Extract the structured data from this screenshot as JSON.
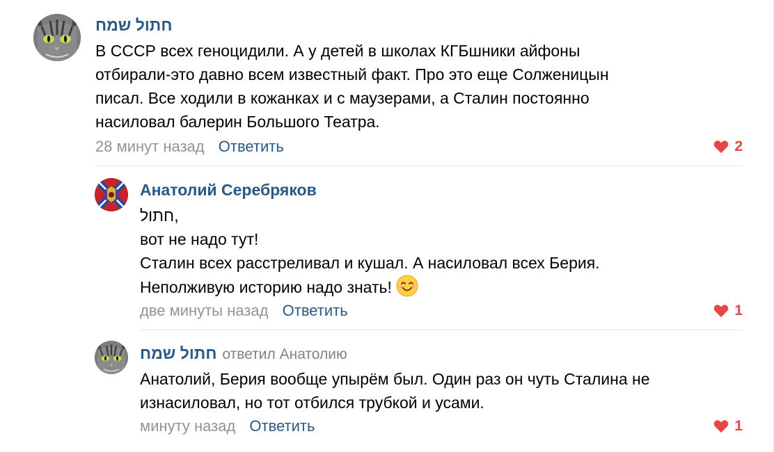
{
  "comments": [
    {
      "author": "חתול שמח",
      "text": "В СССР всех геноцидили. А у детей в школах КГБшники айфоны\nотбирали-это давно всем известный факт. Про это еще Солженицын\nписал. Все ходили в кожанках и с маузерами, а Сталин постоянно\nнасиловал балерин Большого Театра.",
      "time": "28 минут назад",
      "reply_label": "Ответить",
      "likes": "2",
      "avatar_icon": "cat-avatar"
    },
    {
      "author": "Анатолий Серебряков",
      "text": "חתול,\nвот не надо тут!\nСталин всех расстреливал и кушал. А насиловал всех Берия.\nНеполживую историю надо знать!",
      "emoji": "smiling-face-emoji",
      "time": "две минуты назад",
      "reply_label": "Ответить",
      "likes": "1",
      "avatar_icon": "flag-emblem-avatar"
    },
    {
      "author": "חתול שמח",
      "reply_to": "ответил Анатолию",
      "text": "Анатолий, Берия вообще упырём был. Один раз он чуть Сталина не\nизнасиловал, но тот отбился трубкой и усами.",
      "time": "минуту назад",
      "reply_label": "Ответить",
      "likes": "1",
      "avatar_icon": "cat-avatar"
    }
  ],
  "colors": {
    "link": "#2a5885",
    "muted": "#939393",
    "like": "#e64646",
    "divider": "#e7e8ec"
  }
}
